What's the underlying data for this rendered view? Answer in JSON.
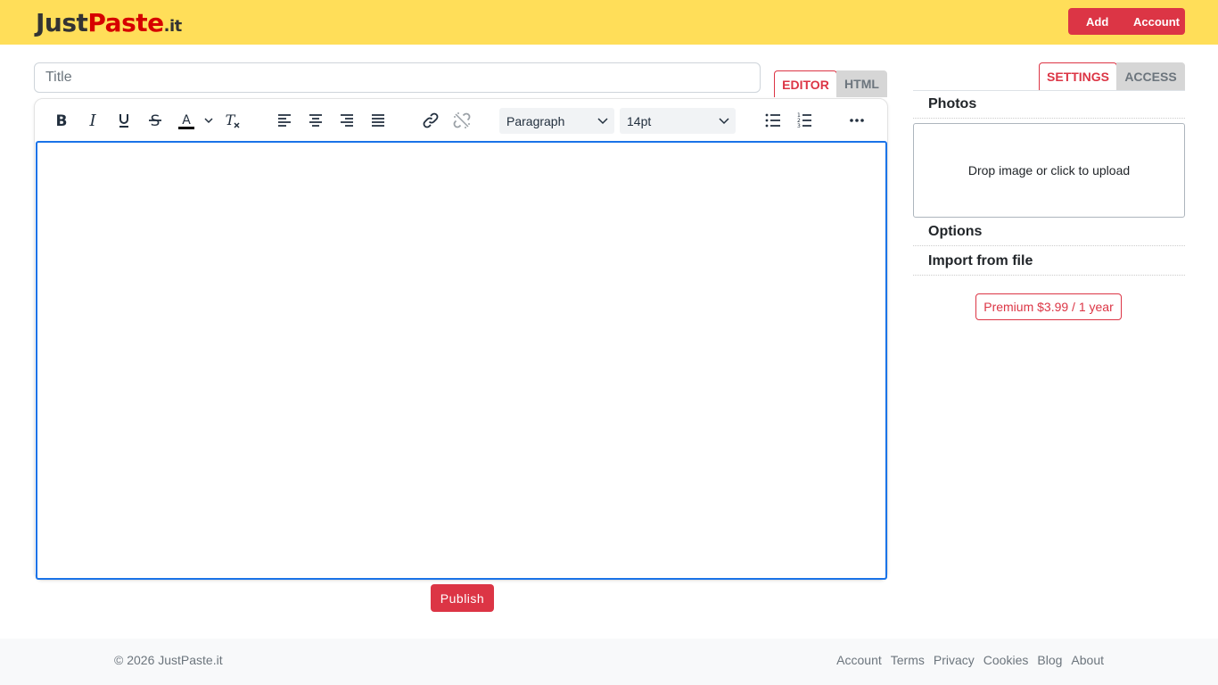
{
  "header": {
    "logo": {
      "part1": "Just",
      "part2": "Paste",
      "part3": ".it"
    },
    "add_label": "Add",
    "account_label": "Account"
  },
  "title_input": {
    "placeholder": "Title",
    "value": ""
  },
  "editor_tabs": [
    {
      "label": "EDITOR",
      "active": true
    },
    {
      "label": "HTML",
      "active": false
    }
  ],
  "toolbar": {
    "buttons": [
      "bold-icon",
      "italic-icon",
      "underline-icon",
      "strikethrough-icon",
      "text-color-icon",
      "clear-formatting-icon",
      "align-left-icon",
      "align-center-icon",
      "align-right-icon",
      "align-justify-icon",
      "link-icon",
      "unlink-icon",
      "bullet-list-icon",
      "numbered-list-icon",
      "more-icon"
    ],
    "block_format": "Paragraph",
    "font_size": "14pt"
  },
  "publish_label": "Publish",
  "sidebar": {
    "tabs": [
      {
        "label": "SETTINGS",
        "active": true
      },
      {
        "label": "ACCESS",
        "active": false
      }
    ],
    "photos_label": "Photos",
    "upload_text": "Drop image or click to upload",
    "options_label": "Options",
    "import_label": "Import from file",
    "premium_label": "Premium $3.99 / 1 year"
  },
  "footer": {
    "copyright": "© 2026 JustPaste.it",
    "links": [
      "Account",
      "Terms",
      "Privacy",
      "Cookies",
      "Blog",
      "About"
    ]
  },
  "colors": {
    "header_bg": "#ffde59",
    "accent": "#dc3545",
    "focus": "#1a73e8"
  }
}
